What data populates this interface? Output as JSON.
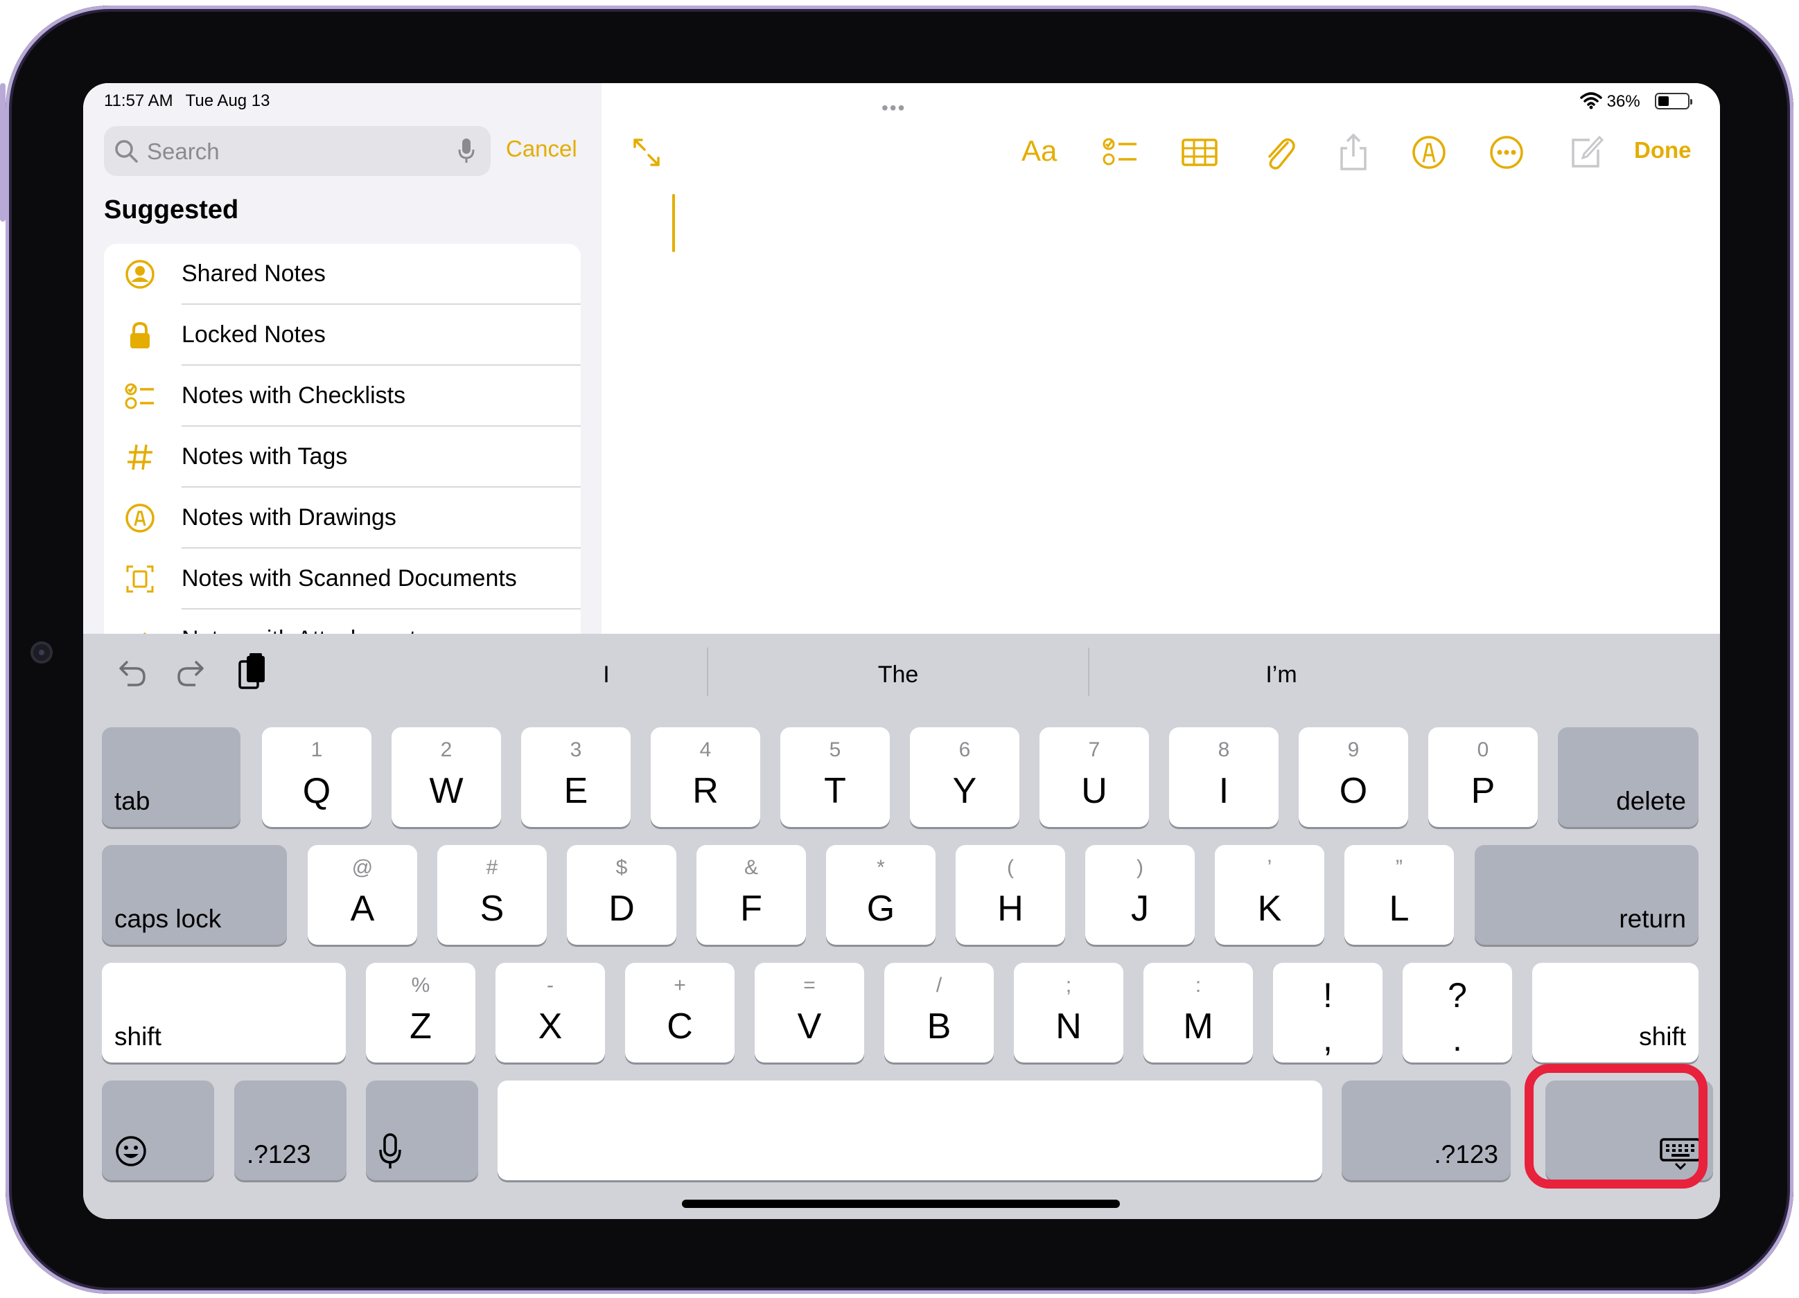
{
  "status": {
    "time": "11:57 AM",
    "date": "Tue Aug 13",
    "battery": "36%"
  },
  "sidebar": {
    "search_placeholder": "Search",
    "cancel_label": "Cancel",
    "section_title": "Suggested",
    "items": [
      {
        "label": "Shared Notes",
        "icon": "person-circle-icon"
      },
      {
        "label": "Locked Notes",
        "icon": "lock-icon"
      },
      {
        "label": "Notes with Checklists",
        "icon": "checklist-icon"
      },
      {
        "label": "Notes with Tags",
        "icon": "hashtag-icon"
      },
      {
        "label": "Notes with Drawings",
        "icon": "pen-circle-icon"
      },
      {
        "label": "Notes with Scanned Documents",
        "icon": "scan-document-icon"
      },
      {
        "label": "Notes with Attachments",
        "icon": "paperclip-icon"
      }
    ]
  },
  "toolbar": {
    "format_label": "Aa",
    "done_label": "Done",
    "icons": [
      "expand-icon",
      "format-icon",
      "checklist-icon",
      "table-icon",
      "attachment-icon",
      "share-icon",
      "markup-icon",
      "more-icon",
      "compose-icon"
    ]
  },
  "keyboard": {
    "suggestions": [
      "I",
      "The",
      "I’m"
    ],
    "row1": {
      "left": "tab",
      "right": "delete",
      "keys": [
        {
          "k": "Q",
          "s": "1"
        },
        {
          "k": "W",
          "s": "2"
        },
        {
          "k": "E",
          "s": "3"
        },
        {
          "k": "R",
          "s": "4"
        },
        {
          "k": "T",
          "s": "5"
        },
        {
          "k": "Y",
          "s": "6"
        },
        {
          "k": "U",
          "s": "7"
        },
        {
          "k": "I",
          "s": "8"
        },
        {
          "k": "O",
          "s": "9"
        },
        {
          "k": "P",
          "s": "0"
        }
      ]
    },
    "row2": {
      "left": "caps lock",
      "right": "return",
      "keys": [
        {
          "k": "A",
          "s": "@"
        },
        {
          "k": "S",
          "s": "#"
        },
        {
          "k": "D",
          "s": "$"
        },
        {
          "k": "F",
          "s": "&"
        },
        {
          "k": "G",
          "s": "*"
        },
        {
          "k": "H",
          "s": "("
        },
        {
          "k": "J",
          "s": ")"
        },
        {
          "k": "K",
          "s": "’"
        },
        {
          "k": "L",
          "s": "”"
        }
      ]
    },
    "row3": {
      "left": "shift",
      "right": "shift",
      "keys": [
        {
          "k": "Z",
          "s": "%"
        },
        {
          "k": "X",
          "s": "-"
        },
        {
          "k": "C",
          "s": "+"
        },
        {
          "k": "V",
          "s": "="
        },
        {
          "k": "B",
          "s": "/"
        },
        {
          "k": "N",
          "s": ";"
        },
        {
          "k": "M",
          "s": ":"
        }
      ],
      "punct": [
        {
          "top": "!",
          "bot": ","
        },
        {
          "top": "?",
          "bot": "."
        }
      ]
    },
    "row4": {
      "numbers_left": ".?123",
      "numbers_right": ".?123"
    },
    "highlight_color": "#e8213c",
    "accent_color": "#e4ad00"
  }
}
